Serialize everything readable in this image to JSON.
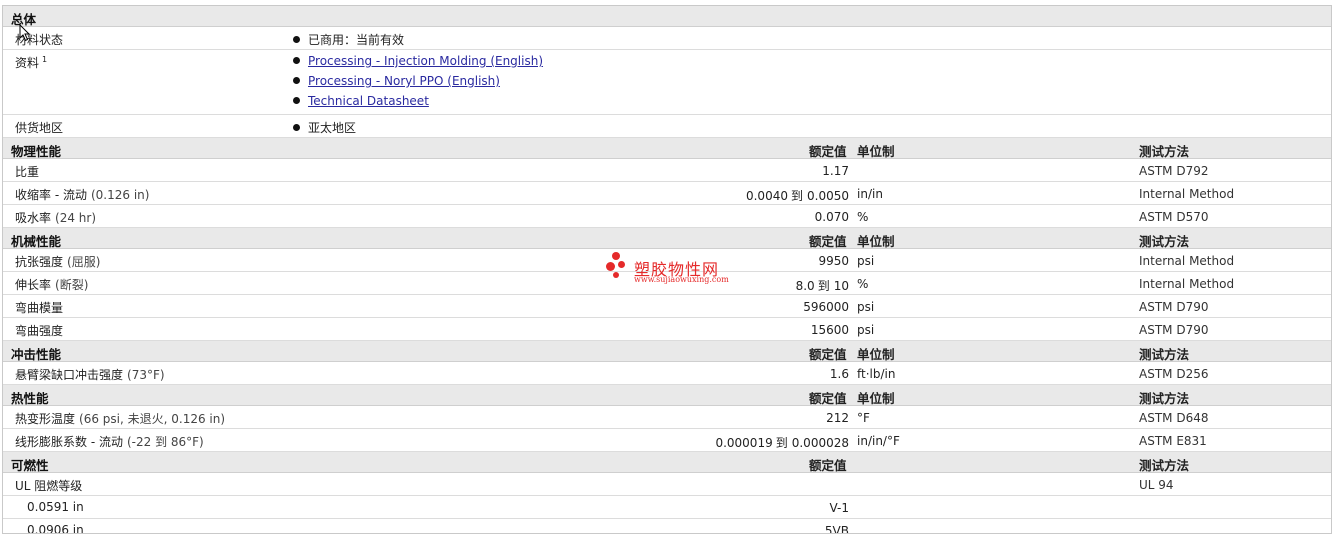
{
  "sections": {
    "general": {
      "title": "总体"
    },
    "physical": {
      "title": "物理性能",
      "col_value": "额定值",
      "col_unit": "单位制",
      "col_method": "测试方法"
    },
    "mechanical": {
      "title": "机械性能",
      "col_value": "额定值",
      "col_unit": "单位制",
      "col_method": "测试方法"
    },
    "impact": {
      "title": "冲击性能",
      "col_value": "额定值",
      "col_unit": "单位制",
      "col_method": "测试方法"
    },
    "thermal": {
      "title": "热性能",
      "col_value": "额定值",
      "col_unit": "单位制",
      "col_method": "测试方法"
    },
    "flammability": {
      "title": "可燃性",
      "col_value": "额定值",
      "col_method": "测试方法"
    }
  },
  "general": {
    "status_label": "材料状态",
    "status_value": "已商用：当前有效",
    "docs_label": "资料",
    "docs_sup": "1",
    "docs": [
      "Processing - Injection Molding (English)",
      "Processing - Noryl PPO (English)",
      "Technical Datasheet"
    ],
    "region_label": "供货地区",
    "region_value": "亚太地区"
  },
  "physical": [
    {
      "label": "比重",
      "cond": "",
      "v1": "1.17",
      "v2": "",
      "unit": "",
      "method": "ASTM D792"
    },
    {
      "label": "收缩率 - 流动",
      "cond": "(0.126 in)",
      "v1": "0.0040",
      "v2": "0.0050",
      "unit": "in/in",
      "method": "Internal Method"
    },
    {
      "label": "吸水率",
      "cond": "(24 hr)",
      "v1": "0.070",
      "v2": "",
      "unit": "%",
      "method": "ASTM D570"
    }
  ],
  "mechanical": [
    {
      "label": "抗张强度",
      "cond": "(屈服)",
      "v1": "9950",
      "v2": "",
      "unit": "psi",
      "method": "Internal Method"
    },
    {
      "label": "伸长率",
      "cond": "(断裂)",
      "v1": "8.0",
      "v2": "10",
      "unit": "%",
      "method": "Internal Method"
    },
    {
      "label": "弯曲模量",
      "cond": "",
      "v1": "596000",
      "v2": "",
      "unit": "psi",
      "method": "ASTM D790"
    },
    {
      "label": "弯曲强度",
      "cond": "",
      "v1": "15600",
      "v2": "",
      "unit": "psi",
      "method": "ASTM D790"
    }
  ],
  "impact": [
    {
      "label": "悬臂梁缺口冲击强度",
      "cond": "(73°F)",
      "v1": "1.6",
      "v2": "",
      "unit": "ft·lb/in",
      "method": "ASTM D256"
    }
  ],
  "thermal": [
    {
      "label": "热变形温度",
      "cond": "(66 psi, 未退火, 0.126 in)",
      "v1": "212",
      "v2": "",
      "unit": "°F",
      "method": "ASTM D648"
    },
    {
      "label": "线形膨胀系数 - 流动",
      "cond": "(-22 到 86°F)",
      "v1": "0.000019",
      "v2": "0.000028",
      "unit": "in/in/°F",
      "method": "ASTM E831"
    }
  ],
  "flammability": [
    {
      "label": "UL 阻燃等级",
      "cond": "",
      "v1": "",
      "v2": "",
      "unit": "",
      "method": "UL 94"
    },
    {
      "label": "0.0591 in",
      "cond": "",
      "v1": "V-1",
      "v2": "",
      "unit": "",
      "method": "",
      "sub": true
    },
    {
      "label": "0.0906 in",
      "cond": "",
      "v1": "5VB",
      "v2": "",
      "unit": "",
      "method": "",
      "sub": true
    }
  ],
  "range_word": "到",
  "watermark": {
    "cn": "塑胶物性网",
    "url": "www.sujiaowuxing.com"
  },
  "colors": {
    "header_bg": "#e9e9e9",
    "link": "#2a2aa0",
    "watermark": "#e52a2a"
  }
}
